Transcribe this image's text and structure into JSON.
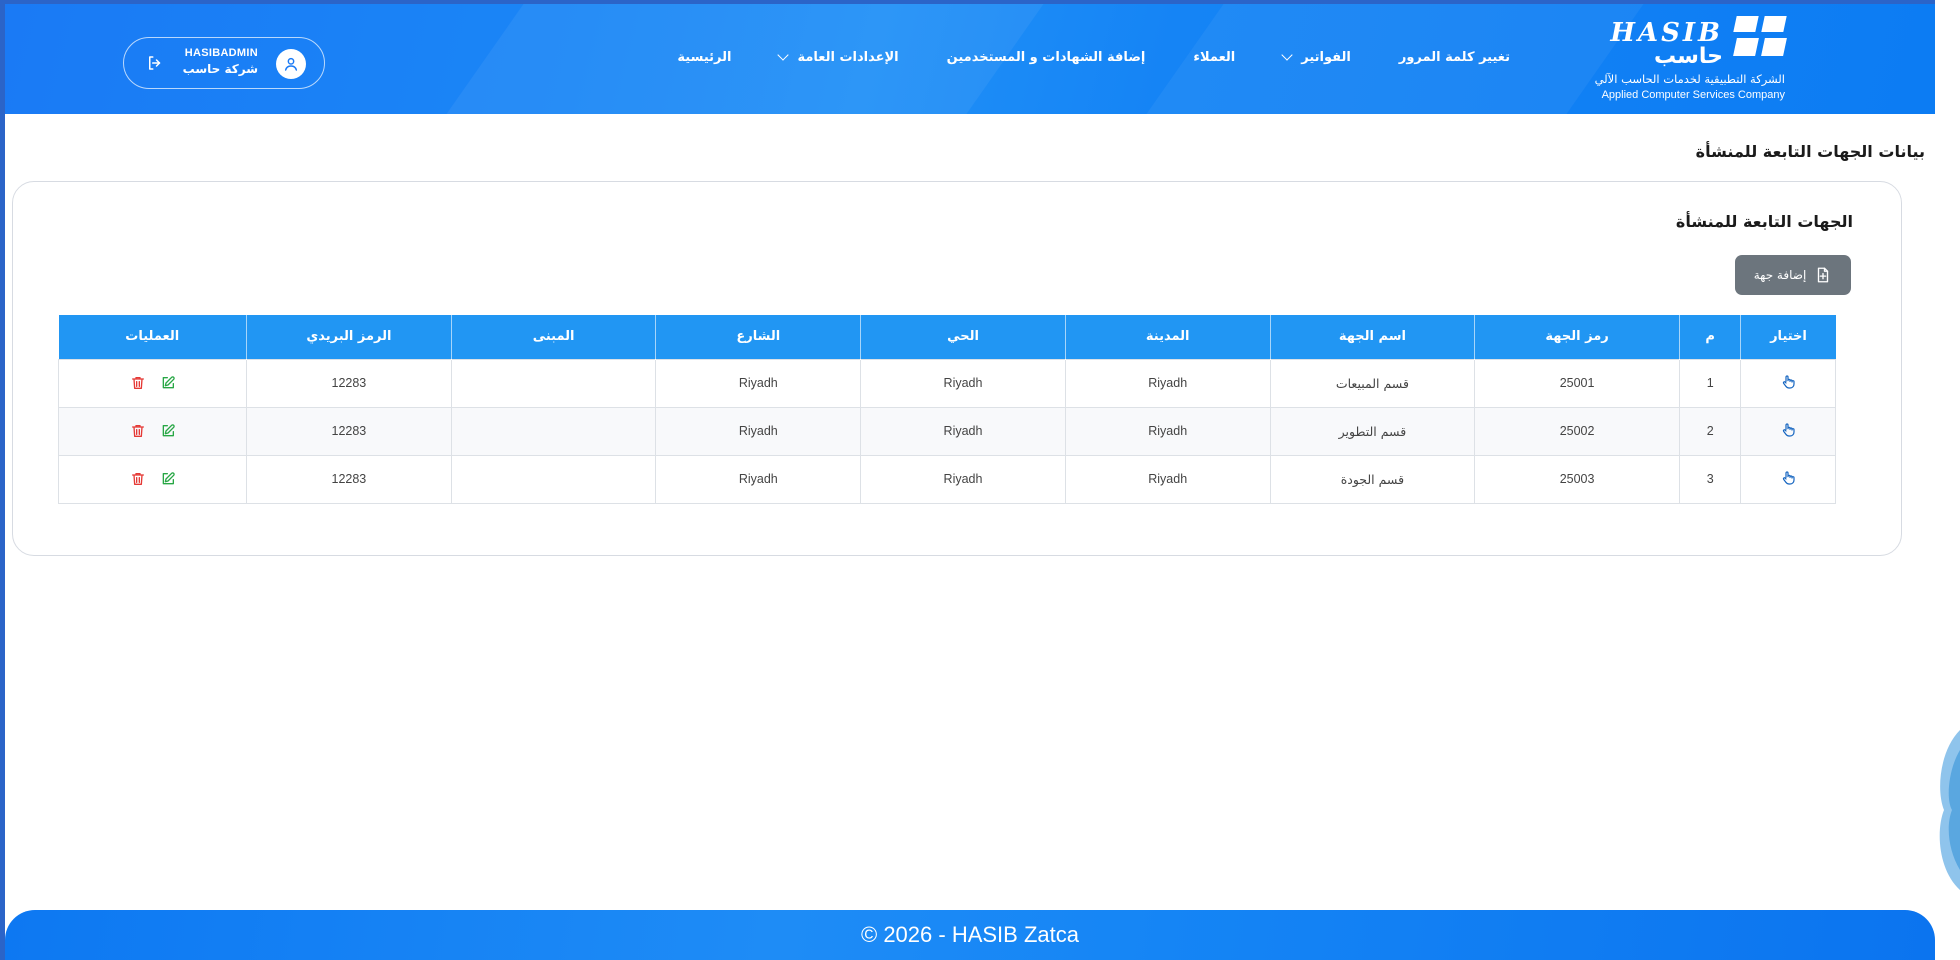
{
  "header": {
    "logo": {
      "brand_en": "HASIB",
      "brand_ar": "حاسب",
      "subtitle_ar": "الشركة التطبيقية لخدمات الحاسب الآلي",
      "subtitle_en": "Applied Computer Services Company"
    },
    "nav": [
      {
        "label": "الرئيسية",
        "dropdown": false
      },
      {
        "label": "الإعدادات العامة",
        "dropdown": true
      },
      {
        "label": "إضافة الشهادات و المستخدمين",
        "dropdown": false
      },
      {
        "label": "العملاء",
        "dropdown": false
      },
      {
        "label": "الفواتير",
        "dropdown": true
      },
      {
        "label": "تغيير كلمة المرور",
        "dropdown": false
      }
    ],
    "user": {
      "name": "HASIBADMIN",
      "company": "شركة حاسب"
    }
  },
  "page": {
    "title": "بيانات الجهات التابعة للمنشأة"
  },
  "card": {
    "title": "الجهات التابعة للمنشأة",
    "add_button_label": "إضافة جهة"
  },
  "table": {
    "columns": [
      "اختيار",
      "م",
      "رمز الجهة",
      "اسم الجهة",
      "المدينة",
      "الحي",
      "الشارع",
      "المبنى",
      "الرمز البريدي",
      "العمليات"
    ],
    "rows": [
      {
        "index": "1",
        "code": "25001",
        "name": "قسم المبيعات",
        "city": "Riyadh",
        "district": "Riyadh",
        "street": "Riyadh",
        "building": "",
        "postal": "12283"
      },
      {
        "index": "2",
        "code": "25002",
        "name": "قسم التطوير",
        "city": "Riyadh",
        "district": "Riyadh",
        "street": "Riyadh",
        "building": "",
        "postal": "12283"
      },
      {
        "index": "3",
        "code": "25003",
        "name": "قسم الجودة",
        "city": "Riyadh",
        "district": "Riyadh",
        "street": "Riyadh",
        "building": "",
        "postal": "12283"
      }
    ]
  },
  "footer": {
    "text": "© 2026 - HASIB Zatca"
  },
  "colors": {
    "header_blue": "#1a86f6",
    "table_header": "#2196f3",
    "select_icon": "#1565c0",
    "edit_icon": "#28a745",
    "delete_icon": "#e53935",
    "add_button": "#6c757d"
  },
  "icons": {
    "select": "hand-pointer-icon",
    "edit": "edit-icon",
    "delete": "trash-icon",
    "add": "file-plus-icon",
    "logout": "logout-icon",
    "avatar": "user-icon",
    "dropdown": "chevron-down-icon"
  }
}
